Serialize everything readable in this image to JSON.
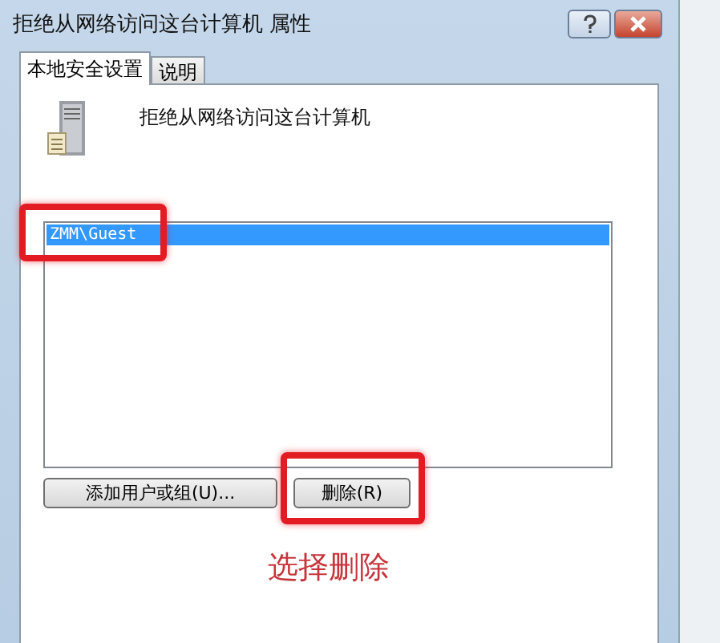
{
  "window": {
    "title": "拒绝从网络访问这台计算机 属性"
  },
  "tabs": [
    {
      "label": "本地安全设置",
      "selected": true
    },
    {
      "label": "说明",
      "selected": false
    }
  ],
  "policy": {
    "title": "拒绝从网络访问这台计算机"
  },
  "accounts": [
    {
      "name": "ZMM\\Guest",
      "selected": true
    }
  ],
  "buttons": [
    {
      "label": "添加用户或组(U)..."
    },
    {
      "label": "删除(R)"
    }
  ],
  "annotation": {
    "text": "选择删除"
  }
}
